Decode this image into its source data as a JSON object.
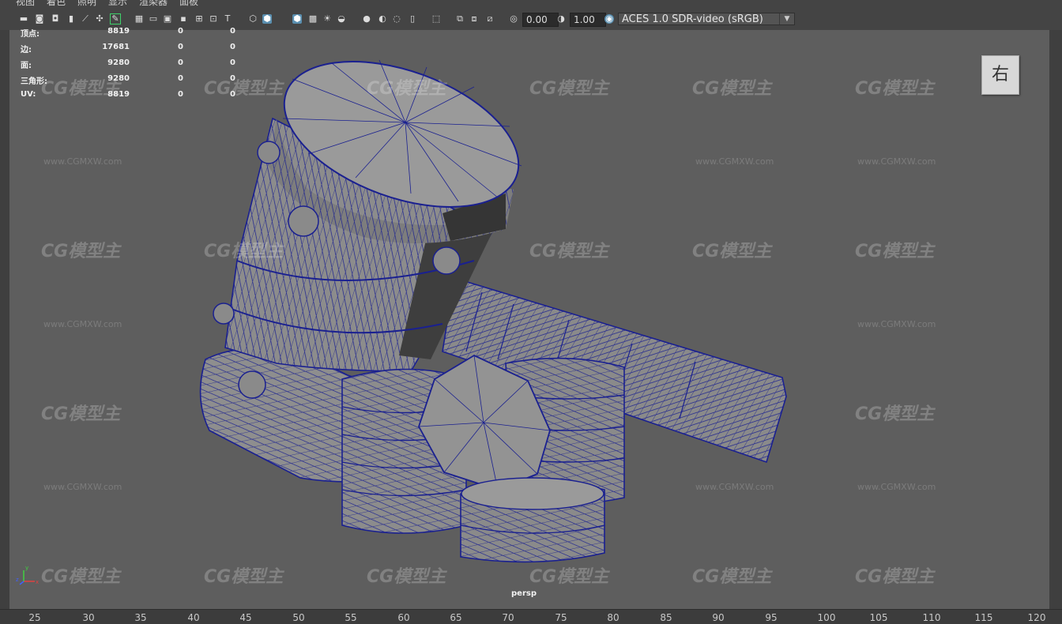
{
  "menu": [
    "视图",
    "着色",
    "照明",
    "显示",
    "渲染器",
    "面板"
  ],
  "toolbar": {
    "field_a": "0.00",
    "field_b": "1.00",
    "color_management": "ACES 1.0 SDR-video (sRGB)"
  },
  "hud": {
    "rows": [
      {
        "label": "顶点:",
        "c1": "8819",
        "c2": "0",
        "c3": "0"
      },
      {
        "label": "边:",
        "c1": "17681",
        "c2": "0",
        "c3": "0"
      },
      {
        "label": "面:",
        "c1": "9280",
        "c2": "0",
        "c3": "0"
      },
      {
        "label": "三角形:",
        "c1": "9280",
        "c2": "0",
        "c3": "0"
      },
      {
        "label": "UV:",
        "c1": "8819",
        "c2": "0",
        "c3": "0"
      }
    ]
  },
  "view_cube_label": "右",
  "camera_label": "persp",
  "axis": {
    "x": "x",
    "y": "y",
    "z": "z"
  },
  "timeline_ticks": [
    "25",
    "30",
    "35",
    "40",
    "45",
    "50",
    "55",
    "60",
    "65",
    "70",
    "75",
    "80",
    "85",
    "90",
    "95",
    "100",
    "105",
    "110",
    "115",
    "120"
  ],
  "watermark": {
    "text": "CG模型主",
    "url": "www.CGMXW.com"
  }
}
